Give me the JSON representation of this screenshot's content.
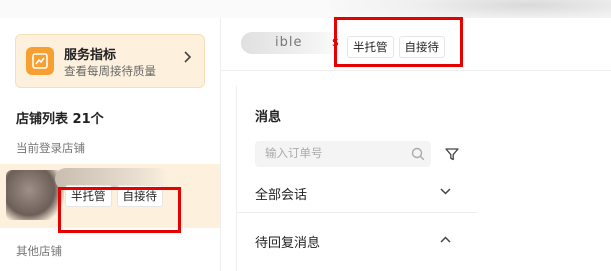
{
  "service_card": {
    "title": "服务指标",
    "subtitle": "查看每周接待质量"
  },
  "store_list": {
    "title": "店铺列表 21个",
    "current_label": "当前登录店铺",
    "current_store": {
      "tags": [
        "半托管",
        "自接待"
      ]
    },
    "other_label": "其他店铺"
  },
  "header": {
    "name_fragment": "ible",
    "name_tail": "s",
    "tags": [
      "半托管",
      "自接待"
    ]
  },
  "messages": {
    "title": "消息",
    "search_placeholder": "输入订单号",
    "rows": [
      {
        "label": "全部会话",
        "state": "collapsed"
      },
      {
        "label": "待回复消息",
        "state": "expanded"
      }
    ]
  },
  "colors": {
    "accent": "#f6a032",
    "highlight_bg": "#fdf1de",
    "annotation_red": "#e60000"
  }
}
